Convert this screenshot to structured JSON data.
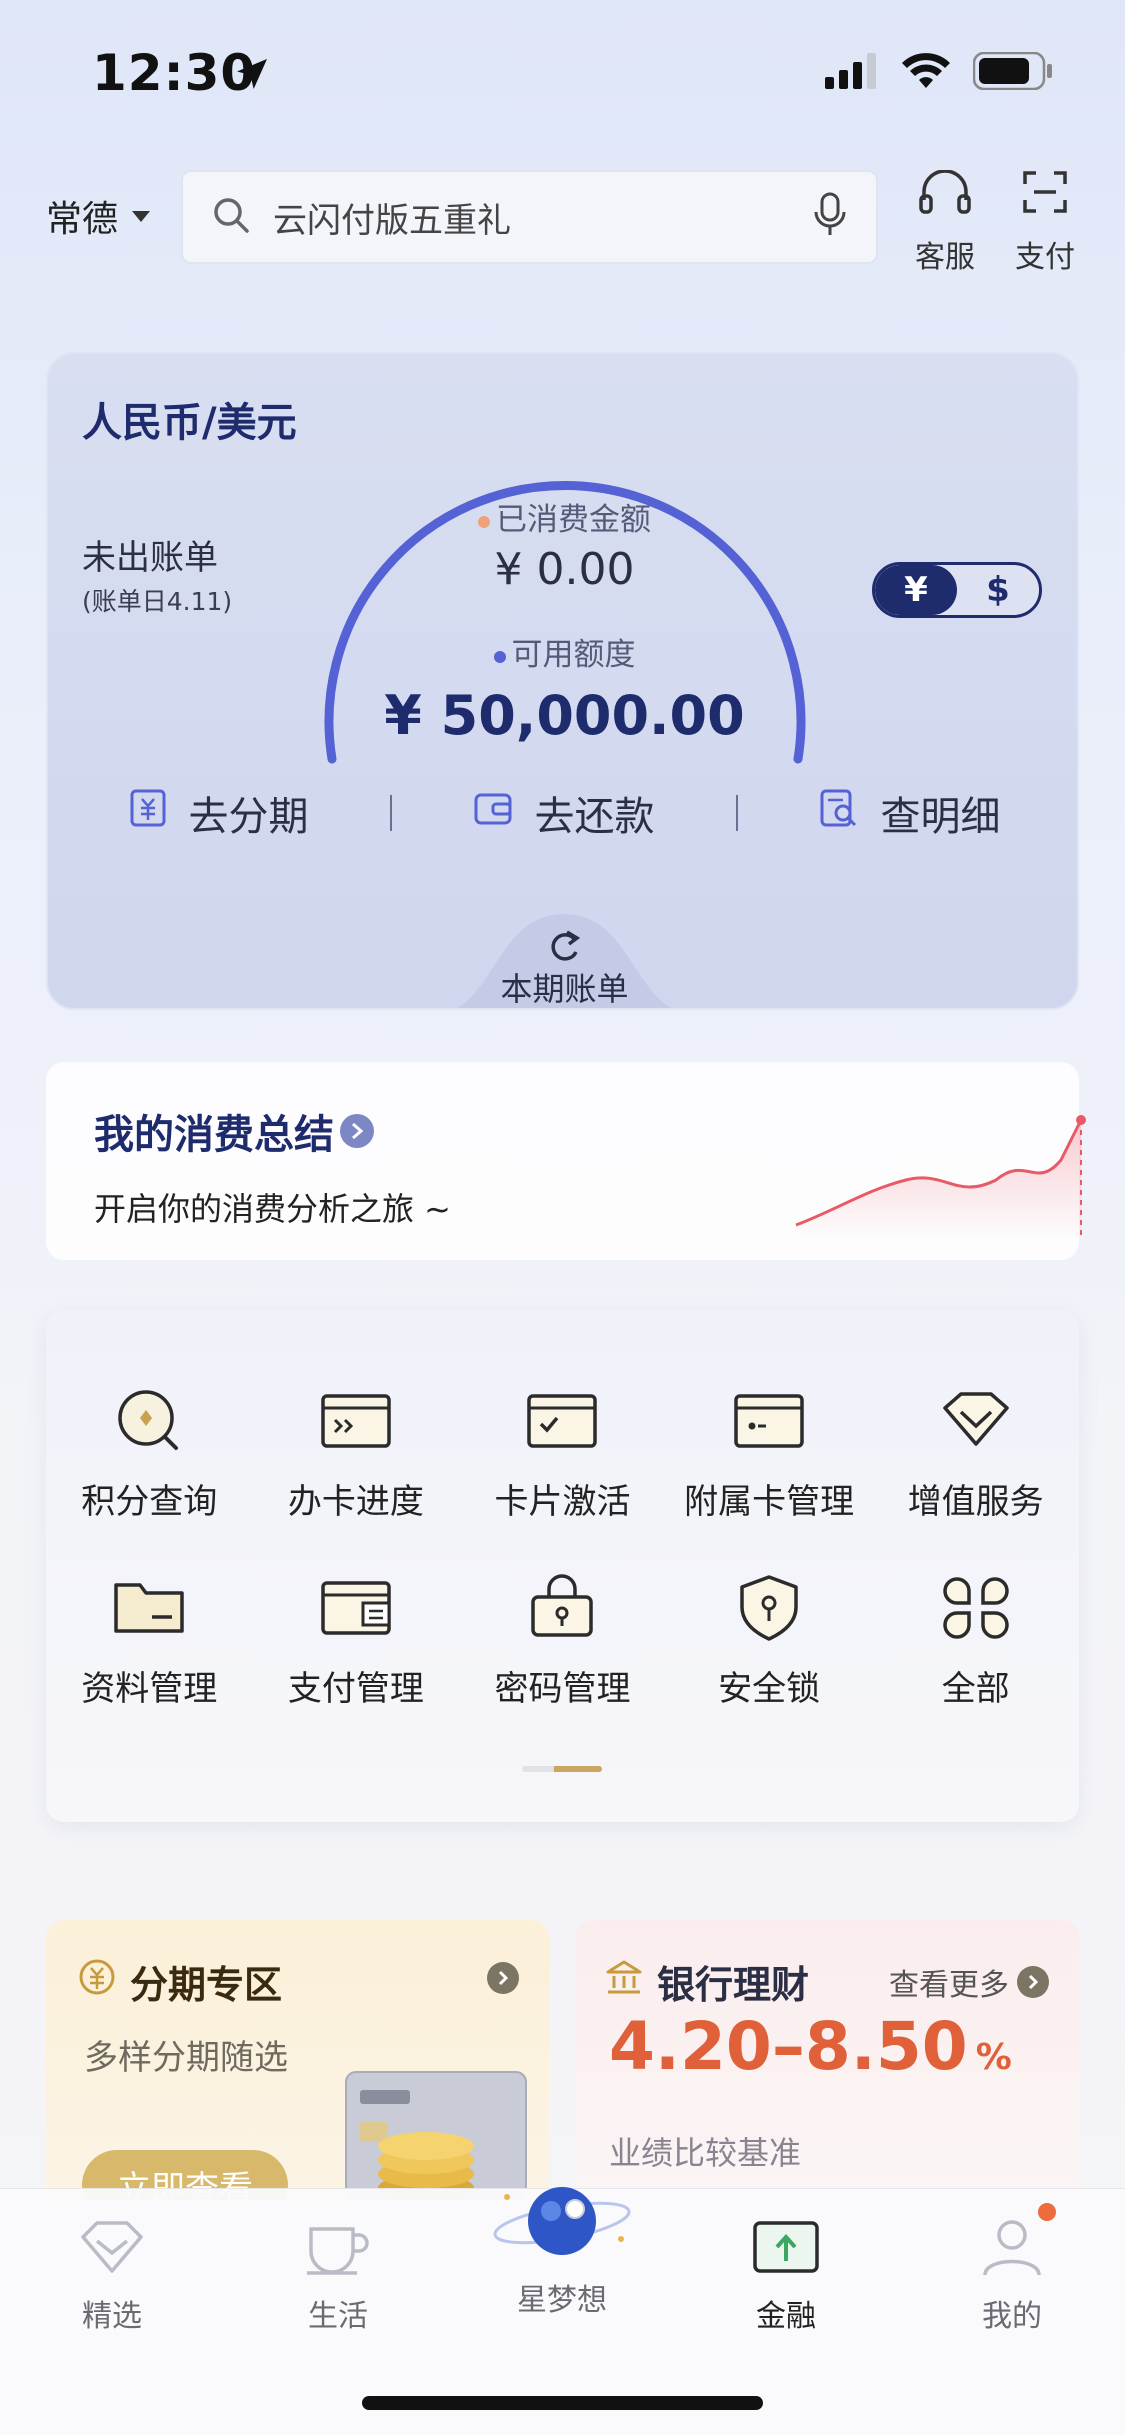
{
  "status_bar": {
    "time": "12:30"
  },
  "header": {
    "city": "常德",
    "search_placeholder": "云闪付版五重礼",
    "customer_service": "客服",
    "pay": "支付"
  },
  "card": {
    "title": "人民币/美元",
    "unbilled_label": "未出账单",
    "bill_day": "(账单日4.11)",
    "spent_label": "已消费金额",
    "spent_value": "¥ 0.00",
    "available_label": "可用额度",
    "available_value": "¥ 50,000.00",
    "currency_options": [
      "¥",
      "$"
    ],
    "actions": [
      "去分期",
      "去还款",
      "查明细"
    ],
    "period_bill": "本期账单",
    "colors": {
      "accent": "#5562d6",
      "spent_dot": "#f0a07a",
      "available_dot": "#5562d6"
    }
  },
  "summary": {
    "title": "我的消费总结",
    "subtitle": "开启你的消费分析之旅 ~"
  },
  "services": [
    {
      "label": "积分查询",
      "icon": "points-search-icon"
    },
    {
      "label": "办卡进度",
      "icon": "card-progress-icon"
    },
    {
      "label": "卡片激活",
      "icon": "card-activate-icon"
    },
    {
      "label": "附属卡管理",
      "icon": "supplementary-card-icon"
    },
    {
      "label": "增值服务",
      "icon": "value-added-icon"
    },
    {
      "label": "资料管理",
      "icon": "profile-folder-icon"
    },
    {
      "label": "支付管理",
      "icon": "payment-wallet-icon"
    },
    {
      "label": "密码管理",
      "icon": "password-lock-icon"
    },
    {
      "label": "安全锁",
      "icon": "security-shield-icon"
    },
    {
      "label": "全部",
      "icon": "all-grid-icon"
    }
  ],
  "promo_installment": {
    "title": "分期专区",
    "subtitle": "多样分期随选",
    "button": "立即查看"
  },
  "promo_wealth": {
    "title": "银行理财",
    "more": "查看更多",
    "rate": "4.20–8.50",
    "rate_unit": "%",
    "rate_note": "业绩比较基准"
  },
  "tabbar": [
    "精选",
    "生活",
    "星梦想",
    "金融",
    "我的"
  ]
}
